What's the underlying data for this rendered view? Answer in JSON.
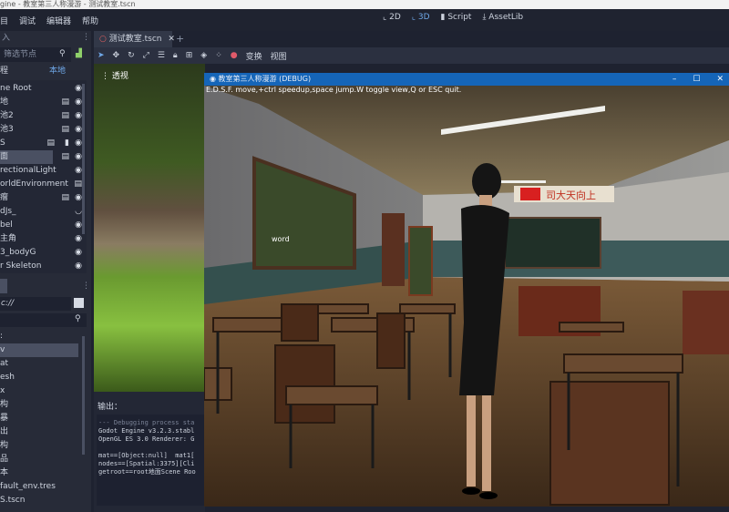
{
  "window_title": "gine - 教室第三人称漫游 - 测试教室.tscn",
  "menu": [
    "目",
    "调试",
    "编辑器",
    "帮助"
  ],
  "workspaces": [
    {
      "label": "2D",
      "icon": "2d-icon"
    },
    {
      "label": "3D",
      "icon": "3d-icon",
      "active": true
    },
    {
      "label": "Script",
      "icon": "script-icon"
    },
    {
      "label": "AssetLib",
      "icon": "assetlib-icon"
    }
  ],
  "scene_dock": {
    "header": "入",
    "filter_placeholder": "筛选节点",
    "tab_scene": "程",
    "tab_local": "本地",
    "nodes": [
      "ne Root",
      "地",
      "池2",
      "池3",
      "S",
      "面",
      "rectionalLight",
      "orldEnvironment",
      "瘤",
      "dJs_",
      "bel",
      "主角",
      "3_bodyG",
      "r Skeleton"
    ]
  },
  "filesystem": {
    "path": "c://",
    "header": ":",
    "files": [
      "v",
      "at",
      "esh",
      "x",
      "构",
      "暴",
      "出",
      "构",
      "品",
      "本",
      "fault_env.tres",
      "S.tscn"
    ]
  },
  "editor": {
    "tab": "测试教室.tscn",
    "toolbar_transform": "变换",
    "toolbar_view": "视图",
    "viewport_label": "透视"
  },
  "output": {
    "title": "输出：",
    "lines": [
      "--- Debugging process sta",
      "Godot Engine v3.2.3.stabl",
      "OpenGL ES 3.0 Renderer: G",
      "",
      "mat==[Object:null]  mat1[",
      "nodes==[Spatial:3375][Cli",
      "getroot==root地面Scene Roo"
    ]
  },
  "game": {
    "title": "教室第三人称漫游 (DEBUG)",
    "hint": "E.D.S.F. move,+ctrl speedup,space jump.W toggle view,Q or ESC quit.",
    "label": "word",
    "banner": "司大天向上"
  }
}
